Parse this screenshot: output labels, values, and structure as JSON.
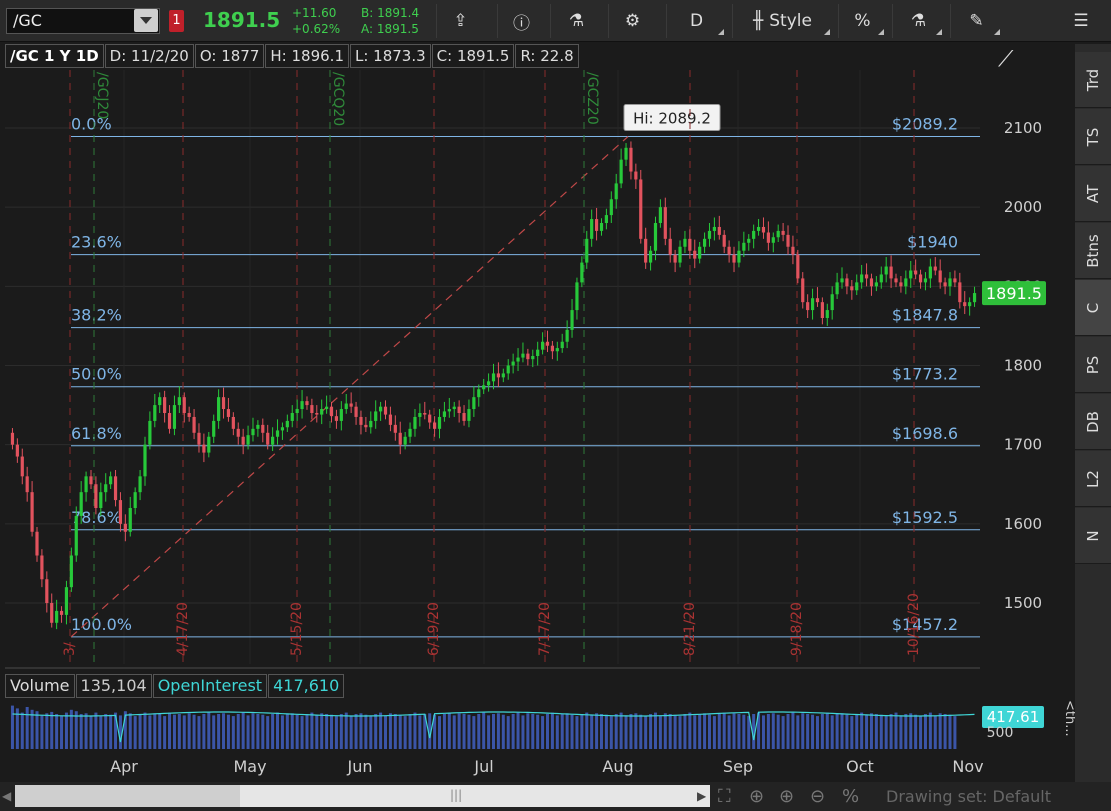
{
  "toolbar": {
    "symbol": "/GC",
    "alert_count": "1",
    "last": "1891.5",
    "change": "+11.60",
    "change_pct": "+0.62%",
    "bid": "B: 1891.4",
    "ask": "A: 1891.5",
    "aggregation": "D",
    "style_label": "Style",
    "buttons": [
      {
        "name": "share-icon",
        "glyph": "⇪"
      },
      {
        "name": "info-icon",
        "glyph": "ⓘ"
      },
      {
        "name": "flask-icon",
        "glyph": "⚗"
      },
      {
        "name": "gear-icon",
        "glyph": "⚙"
      },
      {
        "name": "percent-icon",
        "glyph": "%"
      },
      {
        "name": "studies-icon",
        "glyph": "⚗"
      },
      {
        "name": "drawing-icon",
        "glyph": "✎"
      },
      {
        "name": "menu-icon",
        "glyph": "☰"
      }
    ]
  },
  "chart_header": {
    "title": "/GC 1 Y 1D",
    "date": "D: 11/2/20",
    "open": "O: 1877",
    "high": "H: 1896.1",
    "low": "L: 1873.3",
    "close": "C: 1891.5",
    "range": "R: 22.8"
  },
  "side_tabs": [
    "Trd",
    "TS",
    "AT",
    "Btns",
    "C",
    "PS",
    "DB",
    "L2",
    "N"
  ],
  "volume_header": {
    "volume_label": "Volume",
    "volume_value": "135,104",
    "oi_label": "OpenInterest",
    "oi_value": "417,610"
  },
  "bottom_bar": {
    "drawing_set": "Drawing set: Default"
  },
  "colors": {
    "up": "#27c93a",
    "down": "#e2535e",
    "fib": "#7fb5e6",
    "price_badge": "#2fbf3a",
    "oi_line": "#3fd6d6"
  },
  "chart_data": {
    "type": "candlestick",
    "symbol": "/GC",
    "period": "1 Y 1D",
    "ylim": [
      1430,
      2160
    ],
    "y_ticks": [
      1500,
      1600,
      1700,
      1800,
      1900,
      2000,
      2100
    ],
    "x_ticks": [
      "Apr",
      "May",
      "Jun",
      "Jul",
      "Aug",
      "Sep",
      "Oct",
      "Nov"
    ],
    "last_price_badge": "1891.5",
    "high_annotation": "Hi: 2089.2",
    "fibonacci": [
      {
        "pct": "0.0%",
        "price_label": "$2089.2",
        "price": 2089.2
      },
      {
        "pct": "23.6%",
        "price_label": "$1940",
        "price": 1940.0
      },
      {
        "pct": "38.2%",
        "price_label": "$1847.8",
        "price": 1847.8
      },
      {
        "pct": "50.0%",
        "price_label": "$1773.2",
        "price": 1773.2
      },
      {
        "pct": "61.8%",
        "price_label": "$1698.6",
        "price": 1698.6
      },
      {
        "pct": "78.6%",
        "price_label": "$1592.5",
        "price": 1592.5
      },
      {
        "pct": "100.0%",
        "price_label": "$1457.2",
        "price": 1457.2
      }
    ],
    "expiration_markers": [
      "/GCJ20",
      "/GCQ20",
      "/GCZ20"
    ],
    "event_markers": [
      "3/",
      "4/17/20",
      "5/15/20",
      "6/19/20",
      "7/17/20",
      "8/21/20",
      "9/18/20",
      "10/16/20"
    ],
    "volume_badge": "417.61",
    "volume_axis_label": "500",
    "volume_axis_unit": "<th...",
    "closes": [
      1700,
      1685,
      1660,
      1640,
      1590,
      1560,
      1530,
      1500,
      1475,
      1490,
      1485,
      1520,
      1560,
      1610,
      1640,
      1660,
      1650,
      1620,
      1640,
      1650,
      1660,
      1630,
      1600,
      1590,
      1620,
      1640,
      1660,
      1700,
      1730,
      1750,
      1760,
      1740,
      1720,
      1750,
      1760,
      1740,
      1735,
      1715,
      1700,
      1690,
      1710,
      1730,
      1760,
      1745,
      1735,
      1720,
      1710,
      1700,
      1712,
      1720,
      1725,
      1715,
      1700,
      1710,
      1718,
      1722,
      1730,
      1740,
      1745,
      1755,
      1750,
      1740,
      1738,
      1745,
      1748,
      1736,
      1730,
      1745,
      1752,
      1748,
      1735,
      1725,
      1722,
      1730,
      1742,
      1748,
      1738,
      1725,
      1715,
      1700,
      1710,
      1720,
      1735,
      1740,
      1738,
      1728,
      1720,
      1735,
      1742,
      1745,
      1748,
      1740,
      1730,
      1745,
      1760,
      1770,
      1775,
      1780,
      1790,
      1785,
      1790,
      1800,
      1805,
      1810,
      1815,
      1808,
      1812,
      1820,
      1830,
      1825,
      1818,
      1822,
      1830,
      1845,
      1870,
      1905,
      1930,
      1960,
      1985,
      1970,
      1980,
      1990,
      2010,
      2030,
      2060,
      2075,
      2045,
      2035,
      1960,
      1930,
      1945,
      1980,
      2000,
      1960,
      1940,
      1930,
      1950,
      1960,
      1945,
      1935,
      1950,
      1960,
      1970,
      1975,
      1965,
      1950,
      1940,
      1930,
      1945,
      1955,
      1960,
      1970,
      1975,
      1968,
      1955,
      1962,
      1970,
      1965,
      1950,
      1940,
      1910,
      1880,
      1870,
      1885,
      1880,
      1860,
      1870,
      1890,
      1905,
      1910,
      1900,
      1895,
      1905,
      1915,
      1910,
      1900,
      1905,
      1915,
      1925,
      1910,
      1905,
      1900,
      1910,
      1920,
      1915,
      1905,
      1910,
      1925,
      1920,
      1905,
      1900,
      1910,
      1905,
      1880,
      1875,
      1880,
      1891.5
    ],
    "volumes": [
      620,
      580,
      520,
      600,
      560,
      540,
      480,
      510,
      530,
      500,
      470,
      520,
      560,
      540,
      500,
      510,
      480,
      520,
      470,
      500,
      490,
      520,
      480,
      540,
      510,
      470,
      500,
      520,
      480,
      510,
      500,
      470,
      520,
      490,
      500,
      480,
      510,
      490,
      470,
      500,
      520,
      480,
      500,
      510,
      490,
      470,
      500,
      520,
      480,
      510,
      500,
      490,
      470,
      500,
      520,
      480,
      500,
      510,
      490,
      470,
      500,
      520,
      480,
      510,
      500,
      490,
      470,
      500,
      520,
      480,
      500,
      510,
      490,
      470,
      500,
      520,
      480,
      510,
      500,
      490,
      470,
      500,
      520,
      480,
      500,
      510,
      490,
      470,
      500,
      520,
      480,
      510,
      500,
      490,
      470,
      500,
      520,
      480,
      500,
      510,
      490,
      470,
      500,
      520,
      480,
      510,
      500,
      490,
      470,
      500,
      520,
      480,
      500,
      510,
      490,
      470,
      500,
      520,
      480,
      510,
      500,
      490,
      470,
      500,
      520,
      480,
      500,
      510,
      490,
      470,
      500,
      520,
      480,
      510,
      500,
      490,
      470,
      500,
      520,
      480,
      500,
      510,
      490,
      470,
      500,
      520,
      480,
      510,
      500,
      490,
      470,
      500,
      520,
      480,
      500,
      510,
      490,
      470,
      500,
      520,
      480,
      510,
      500,
      490,
      470,
      500,
      520,
      480,
      500,
      510,
      490,
      470,
      500,
      520,
      480,
      510,
      500,
      490,
      470,
      500,
      520,
      480,
      500,
      510,
      490,
      470,
      500,
      520,
      480,
      510,
      500,
      490,
      470
    ]
  }
}
